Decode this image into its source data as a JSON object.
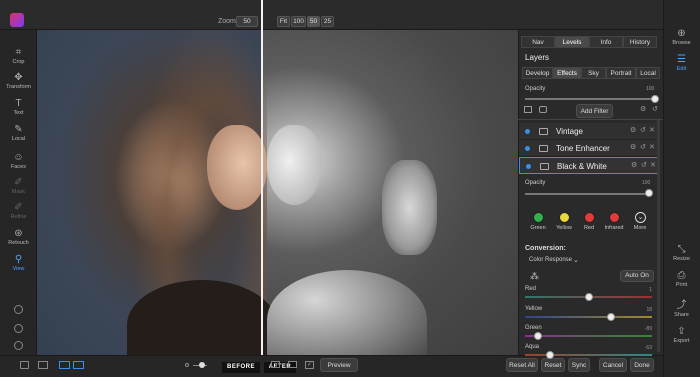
{
  "toolbar": {
    "zoom_label": "Zoom",
    "zoom_value": "50",
    "zoom_presets": [
      "Fit",
      "100",
      "50",
      "25"
    ]
  },
  "left_tools": [
    {
      "name": "crop",
      "label": "Crop",
      "icon": "⌗",
      "state": "normal"
    },
    {
      "name": "transform",
      "label": "Transform",
      "icon": "✥",
      "state": "normal"
    },
    {
      "name": "text",
      "label": "Text",
      "icon": "T",
      "state": "normal"
    },
    {
      "name": "local",
      "label": "Local",
      "icon": "✎",
      "state": "normal"
    },
    {
      "name": "faces",
      "label": "Faces",
      "icon": "☺",
      "state": "normal"
    },
    {
      "name": "mask",
      "label": "Mask",
      "icon": "✐",
      "state": "dim"
    },
    {
      "name": "refine",
      "label": "Refine",
      "icon": "✐",
      "state": "dim"
    },
    {
      "name": "retouch",
      "label": "Retouch",
      "icon": "⊛",
      "state": "normal"
    },
    {
      "name": "view",
      "label": "View",
      "icon": "⚲",
      "state": "active"
    }
  ],
  "compare": {
    "before": "BEFORE",
    "after": "AFTER"
  },
  "bottom": {
    "preview": "Preview",
    "reset_all": "Reset All",
    "reset": "Reset",
    "sync": "Sync",
    "cancel": "Cancel",
    "done": "Done"
  },
  "panel": {
    "tabs": [
      "Nav",
      "Levels",
      "Info",
      "History"
    ],
    "selected_tab": "Levels",
    "layers_title": "Layers",
    "subtabs": [
      "Develop",
      "Effects",
      "Sky",
      "Portrait",
      "Local"
    ],
    "selected_subtab": "Effects",
    "opacity_label": "Opacity",
    "opacity_value": "100",
    "add_filter": "Add Filter",
    "layers": [
      "Vintage",
      "Tone Enhancer",
      "Black & White"
    ],
    "bw": {
      "opacity_label": "Opacity",
      "opacity_value": "100",
      "presets": [
        {
          "label": "Green",
          "color": "#2fb34a"
        },
        {
          "label": "Yellow",
          "color": "#e8d83a"
        },
        {
          "label": "Red",
          "color": "#e23a3a"
        },
        {
          "label": "Infrared",
          "color": "#e23a3a"
        },
        {
          "label": "More",
          "color": ""
        }
      ],
      "conversion_title": "Conversion:",
      "color_response": "Color Response",
      "auto_on": "Auto On",
      "sliders": [
        {
          "label": "Red",
          "value": "1",
          "level": 0.5
        },
        {
          "label": "Yellow",
          "value": "18",
          "level": 0.68
        },
        {
          "label": "Green",
          "value": "-89",
          "level": 0.1
        },
        {
          "label": "Aqua",
          "value": "-63",
          "level": 0.2
        }
      ]
    }
  },
  "right_tools": [
    {
      "name": "browse",
      "label": "Browse",
      "icon": "⊕",
      "state": "normal"
    },
    {
      "name": "edit",
      "label": "Edit",
      "icon": "☰",
      "state": "active"
    },
    {
      "name": "resize",
      "label": "Resize",
      "icon": "⤡",
      "state": "normal"
    },
    {
      "name": "print",
      "label": "Print",
      "icon": "⎙",
      "state": "normal"
    },
    {
      "name": "share",
      "label": "Share",
      "icon": "⤴",
      "state": "normal"
    },
    {
      "name": "export",
      "label": "Export",
      "icon": "⇪",
      "state": "normal"
    }
  ]
}
